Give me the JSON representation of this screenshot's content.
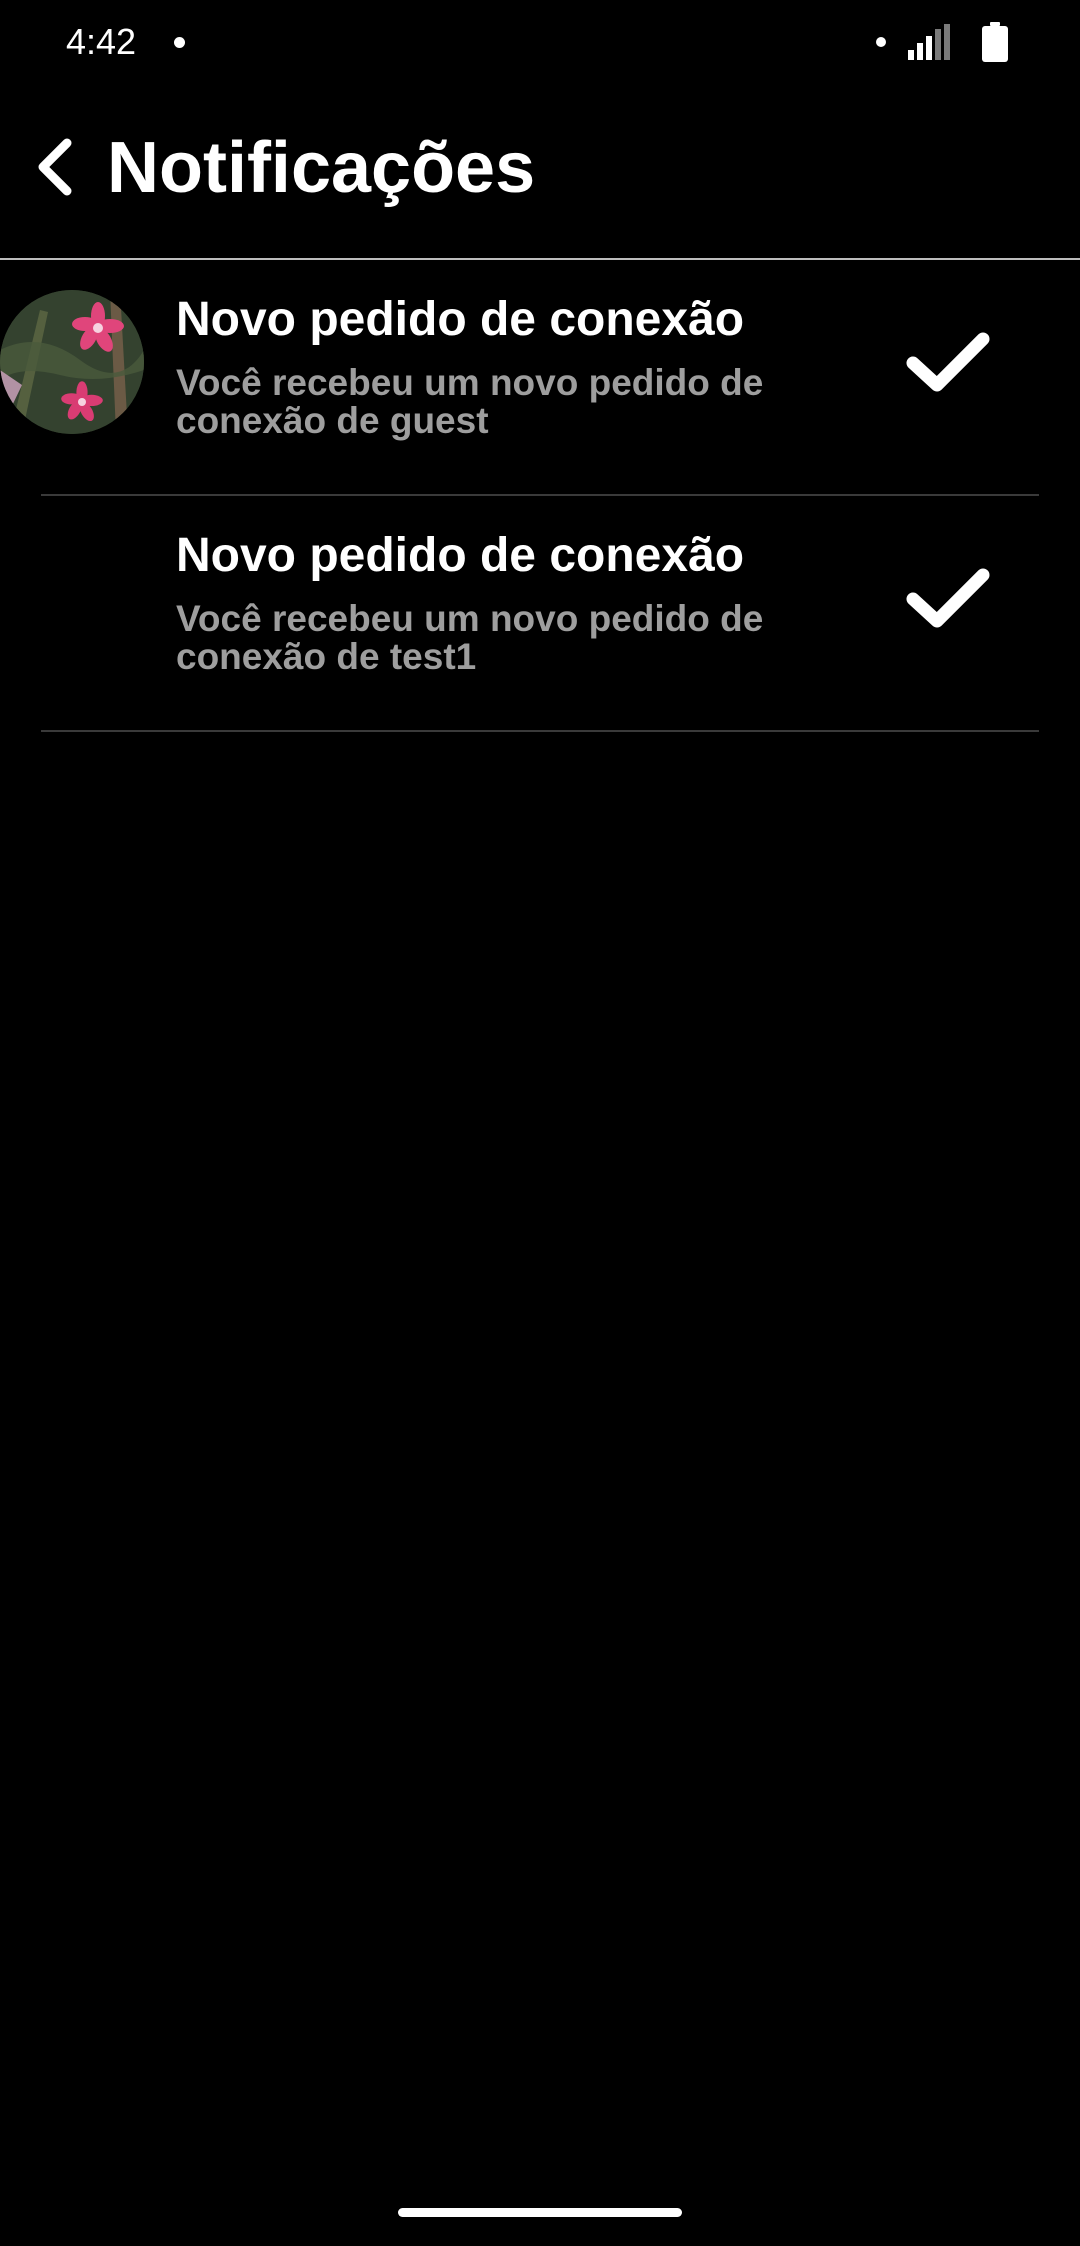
{
  "status_bar": {
    "time": "4:42",
    "icons": [
      "notification-dot-icon",
      "signal-icon",
      "battery-icon"
    ]
  },
  "header": {
    "back_icon": "chevron-left-icon",
    "title": "Notificações"
  },
  "notifications": [
    {
      "title": "Novo pedido de conexão",
      "body": "Você recebeu um novo pedido de conexão de guest",
      "has_avatar": true,
      "action_icon": "check-icon"
    },
    {
      "title": "Novo pedido de conexão",
      "body": "Você recebeu um novo pedido de conexão de test1",
      "has_avatar": false,
      "action_icon": "check-icon"
    }
  ],
  "colors": {
    "background": "#000000",
    "text_primary": "#ffffff",
    "text_secondary": "#9e9e9e",
    "divider": "#3a3a3a"
  }
}
